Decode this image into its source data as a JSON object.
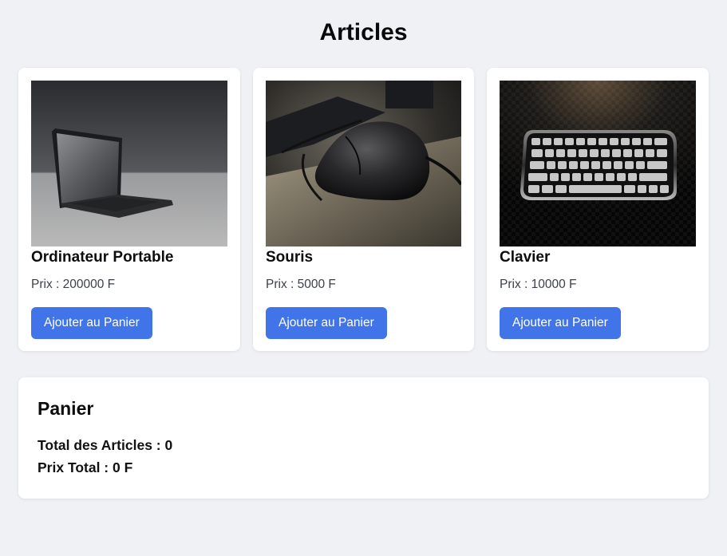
{
  "page": {
    "title": "Articles"
  },
  "products": [
    {
      "name": "Ordinateur Portable",
      "price_text": "Prix : 200000 F",
      "button_label": "Ajouter au Panier",
      "image_icon": "laptop-photo"
    },
    {
      "name": "Souris",
      "price_text": "Prix : 5000 F",
      "button_label": "Ajouter au Panier",
      "image_icon": "mouse-photo"
    },
    {
      "name": "Clavier",
      "price_text": "Prix : 10000 F",
      "button_label": "Ajouter au Panier",
      "image_icon": "keyboard-photo"
    }
  ],
  "cart": {
    "title": "Panier",
    "total_items_text": "Total des Articles : 0",
    "total_price_text": "Prix Total : 0 F"
  },
  "colors": {
    "background": "#f0f1f5",
    "accent": "#4274e9",
    "card": "#ffffff"
  }
}
